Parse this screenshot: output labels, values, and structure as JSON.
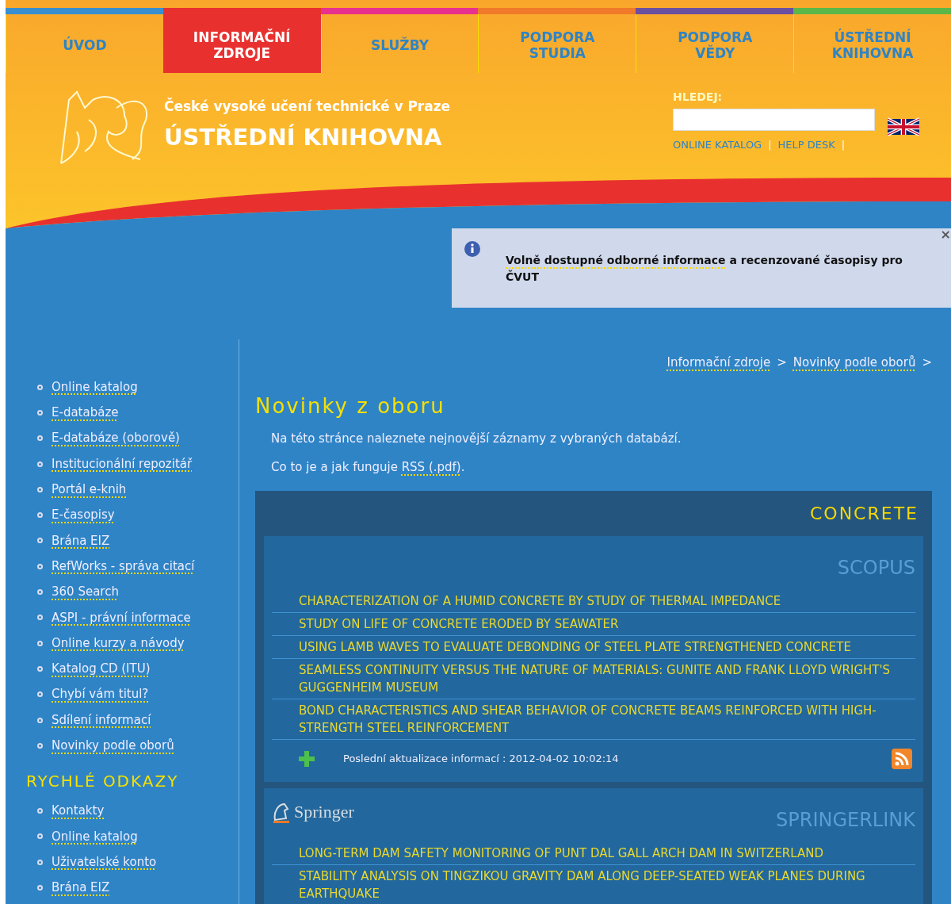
{
  "nav": [
    {
      "label": "ÚVOD",
      "color": "#3a8fd0",
      "selected": false
    },
    {
      "label": "INFORMAČNÍ ZDROJE",
      "color": "#e8312f",
      "selected": true
    },
    {
      "label": "SLUŽBY",
      "color": "#e8318e",
      "selected": false
    },
    {
      "label": "PODPORA STUDIA",
      "color": "#f07a2a",
      "selected": false
    },
    {
      "label": "PODPORA VĚDY",
      "color": "#6b4fa0",
      "selected": false
    },
    {
      "label": "ÚSTŘEDNÍ KNIHOVNA",
      "color": "#5bb848",
      "selected": false
    }
  ],
  "header": {
    "subtitle": "České vysoké učení technické v Praze",
    "title": "ÚSTŘEDNÍ KNIHOVNA"
  },
  "search": {
    "label": "HLEDEJ:",
    "links": [
      "ONLINE KATALOG",
      "HELP DESK"
    ],
    "separator": "|"
  },
  "notice": {
    "link": "Volně dostupné odborné informace",
    "text": " a recenzované časopisy pro ČVUT",
    "close": "×"
  },
  "sidebar": {
    "items": [
      "Online katalog",
      "E-databáze",
      "E-databáze (oborově)",
      "Institucionální repozitář",
      "Portál e-knih",
      "E-časopisy",
      "Brána EIZ",
      "RefWorks - správa citací",
      "360 Search",
      "ASPI - právní informace",
      "Online kurzy a návody",
      "Katalog CD (ITU)",
      "Chybí vám titul?",
      "Sdílení informací",
      "Novinky podle oborů"
    ],
    "quick_title": "RYCHLÉ ODKAZY",
    "quick_items": [
      "Kontakty",
      "Online katalog",
      "Uživatelské konto",
      "Brána EIZ"
    ]
  },
  "breadcrumb": [
    "Informační zdroje",
    "Novinky podle oborů"
  ],
  "breadcrumb_separator": ">",
  "page": {
    "title": "Novinky z oboru",
    "intro": "Na této stránce naleznete nejnovější záznamy z vybraných databází.",
    "rss_prefix": "Co to je a jak funguje ",
    "rss_link": "RSS (.pdf)",
    "rss_suffix": "."
  },
  "topic": {
    "title": "CONCRETE",
    "sources": [
      {
        "name": "SCOPUS",
        "kind": "plain",
        "articles": [
          "CHARACTERIZATION OF A HUMID CONCRETE BY STUDY OF THERMAL IMPEDANCE",
          "STUDY ON LIFE OF CONCRETE ERODED BY SEAWATER",
          "USING LAMB WAVES TO EVALUATE DEBONDING OF STEEL PLATE STRENGTHENED CONCRETE",
          "SEAMLESS CONTINUITY VERSUS THE NATURE OF MATERIALS: GUNITE AND FRANK LLOYD WRIGHT'S GUGGENHEIM MUSEUM",
          "BOND CHARACTERISTICS AND SHEAR BEHAVIOR OF CONCRETE BEAMS REINFORCED WITH HIGH-STRENGTH STEEL REINFORCEMENT"
        ],
        "updated": "Poslední aktualizace informací : 2012-04-02 10:02:14"
      },
      {
        "name": "SPRINGERLINK",
        "kind": "logo",
        "logo": "Springer",
        "articles": [
          "LONG-TERM DAM SAFETY MONITORING OF PUNT DAL GALL ARCH DAM IN SWITZERLAND",
          "STABILITY ANALYSIS ON TINGZIKOU GRAVITY DAM ALONG DEEP-SEATED WEAK PLANES DURING EARTHQUAKE"
        ]
      }
    ]
  }
}
